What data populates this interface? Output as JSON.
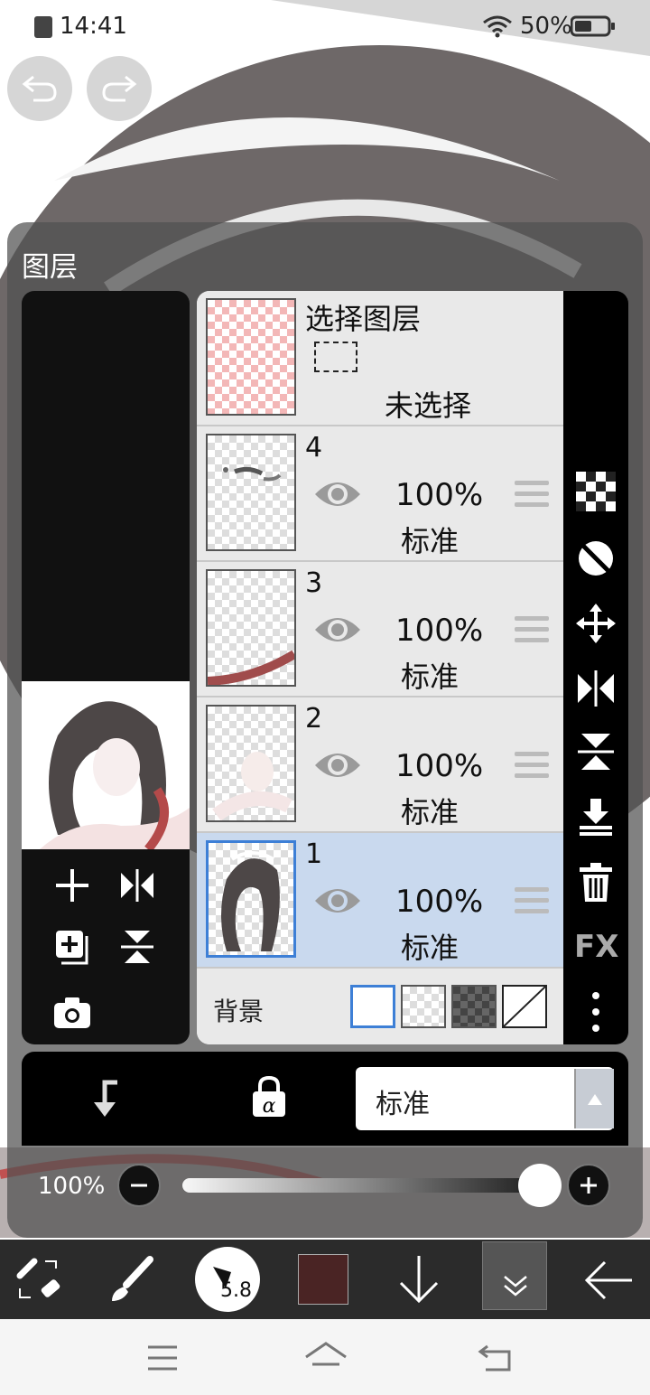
{
  "status_bar": {
    "time": "14:41",
    "battery": "50%"
  },
  "layer_panel": {
    "title": "图层",
    "selection_layer": {
      "title": "选择图层",
      "state": "未选择"
    },
    "layers": [
      {
        "number": "4",
        "opacity": "100%",
        "mode": "标准",
        "selected": false
      },
      {
        "number": "3",
        "opacity": "100%",
        "mode": "标准",
        "selected": false
      },
      {
        "number": "2",
        "opacity": "100%",
        "mode": "标准",
        "selected": false
      },
      {
        "number": "1",
        "opacity": "100%",
        "mode": "标准",
        "selected": true
      }
    ],
    "background_label": "背景",
    "blend_mode": "标准",
    "opacity_value": "100%",
    "fx_label": "FX"
  },
  "toolbar": {
    "brush_size": "5.8",
    "current_color": "#4a2424"
  },
  "colors": {
    "accent": "#3d7fd6",
    "panel_bg": "#505050",
    "selected_row": "#c9d9ee"
  }
}
